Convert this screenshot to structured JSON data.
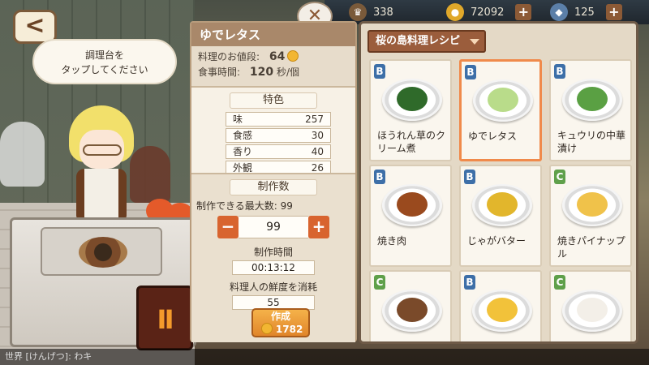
{
  "topbar": {
    "stamina": "338",
    "coins": "72092",
    "gems": "125"
  },
  "hint_bubble": {
    "line1": "調理台を",
    "line2": "タップしてください"
  },
  "detail": {
    "dish_name": "ゆでレタス",
    "price_label": "料理のお値段:",
    "price_value": "64",
    "time_label": "食事時間:",
    "time_value": "120",
    "time_unit": "秒/個",
    "traits_title": "特色",
    "stats": [
      {
        "label": "味",
        "value": "257"
      },
      {
        "label": "食感",
        "value": "30"
      },
      {
        "label": "香り",
        "value": "40"
      },
      {
        "label": "外観",
        "value": "26"
      }
    ],
    "make_count_title": "制作数",
    "max_label": "制作できる最大数: 99",
    "quantity": "99",
    "minus": "−",
    "plus": "+",
    "make_time_label": "制作時間",
    "make_time_value": "00:13:12",
    "freshness_label": "料理人の鮮度を消耗",
    "freshness_value": "55",
    "make_button": "作成",
    "make_cost": "1782"
  },
  "recipes": {
    "dropdown": "桜の島料理レシピ",
    "items": [
      {
        "name": "ほうれん草のクリーム煮",
        "tier": "B",
        "selected": false,
        "food_color": "#2f6a2a"
      },
      {
        "name": "ゆでレタス",
        "tier": "B",
        "selected": true,
        "food_color": "#b9dc8a"
      },
      {
        "name": "キュウリの中華漬け",
        "tier": "B",
        "selected": false,
        "food_color": "#5aa043"
      },
      {
        "name": "焼き肉",
        "tier": "B",
        "selected": false,
        "food_color": "#9a4a1e"
      },
      {
        "name": "じゃがバター",
        "tier": "B",
        "selected": false,
        "food_color": "#e2b62c"
      },
      {
        "name": "焼きパイナップル",
        "tier": "C",
        "selected": false,
        "food_color": "#f0c24a"
      },
      {
        "name": "",
        "tier": "C",
        "selected": false,
        "food_color": "#7a4a2a"
      },
      {
        "name": "",
        "tier": "B",
        "selected": false,
        "food_color": "#f2c23a"
      },
      {
        "name": "",
        "tier": "C",
        "selected": false,
        "food_color": "#f3efe8"
      }
    ]
  },
  "ticker": "世界 [けんげつ]: わキ"
}
